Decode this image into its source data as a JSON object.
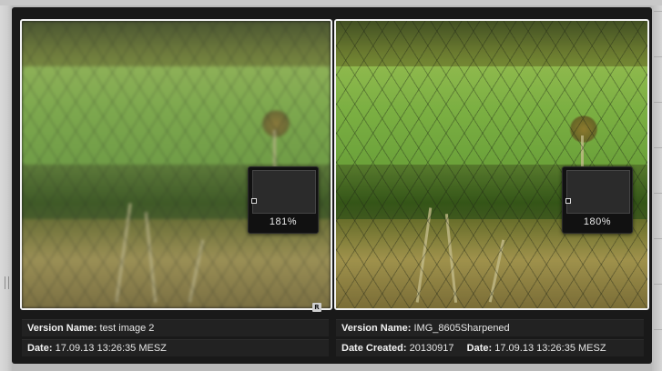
{
  "left_version": {
    "name_label": "Version Name:",
    "name_value": "test image 2",
    "date_label": "Date:",
    "date_value": "17.09.13 13:26:35 MESZ",
    "zoom": "181%",
    "badge": "R"
  },
  "right_version": {
    "name_label": "Version Name:",
    "name_value": "IMG_8605Sharpened",
    "created_label": "Date Created:",
    "created_value": "20130917",
    "date_label": "Date:",
    "date_value": "17.09.13 13:26:35 MESZ",
    "zoom": "180%"
  },
  "colors": {
    "viewer_bg": "#191919",
    "info_bg": "#222222",
    "selection_border": "#f2f2f2",
    "text": "#e6e6e6"
  },
  "icons": [
    "resize-grip-icon",
    "reference-badge-icon",
    "loupe-icon"
  ]
}
